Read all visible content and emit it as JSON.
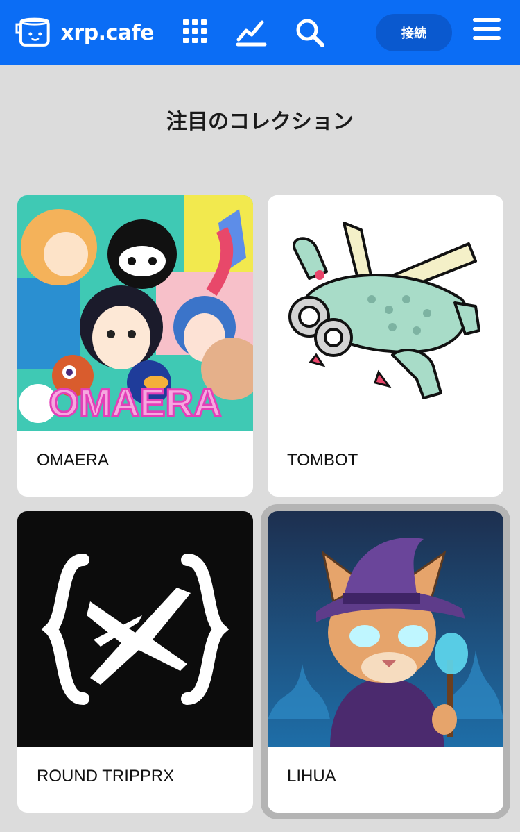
{
  "header": {
    "brand": "xrp.cafe",
    "connect_label": "接続",
    "icons": [
      "grid-icon",
      "chart-icon",
      "search-icon",
      "hamburger-menu-icon"
    ],
    "bg_color": "#0b6df5"
  },
  "section": {
    "title": "注目のコレクション"
  },
  "collections": [
    {
      "name": "OMAERA",
      "image_text": "OMAERA"
    },
    {
      "name": "TOMBOT"
    },
    {
      "name": "ROUND TRIPPRX"
    },
    {
      "name": "LIHUA"
    }
  ]
}
